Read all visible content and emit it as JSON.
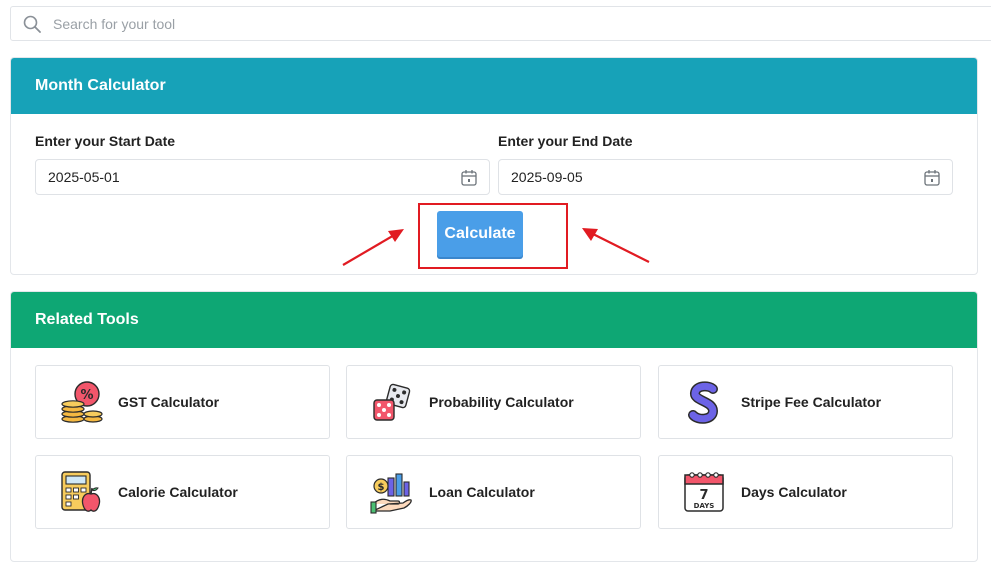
{
  "search": {
    "placeholder": "Search for your tool",
    "icon": "search-icon"
  },
  "calculator": {
    "title": "Month Calculator",
    "header_color": "#17a2b8",
    "start": {
      "label": "Enter your Start Date",
      "value": "2025-05-01",
      "icon": "calendar-icon"
    },
    "end": {
      "label": "Enter your End Date",
      "value": "2025-09-05",
      "icon": "calendar-icon"
    },
    "button_label": "Calculate",
    "button_color": "#4a9ee8",
    "annotation_color": "#e11b22"
  },
  "related": {
    "title": "Related Tools",
    "header_color": "#0ea774",
    "tools": [
      {
        "label": "GST Calculator",
        "icon": "gst-coins-icon"
      },
      {
        "label": "Probability Calculator",
        "icon": "dice-icon"
      },
      {
        "label": "Stripe Fee Calculator",
        "icon": "stripe-s-icon"
      },
      {
        "label": "Calorie Calculator",
        "icon": "calculator-apple-icon"
      },
      {
        "label": "Loan Calculator",
        "icon": "loan-hand-icon"
      },
      {
        "label": "Days Calculator",
        "icon": "calendar-7-days-icon"
      }
    ],
    "days_icon_text": {
      "number": "7",
      "word": "DAYS"
    }
  }
}
